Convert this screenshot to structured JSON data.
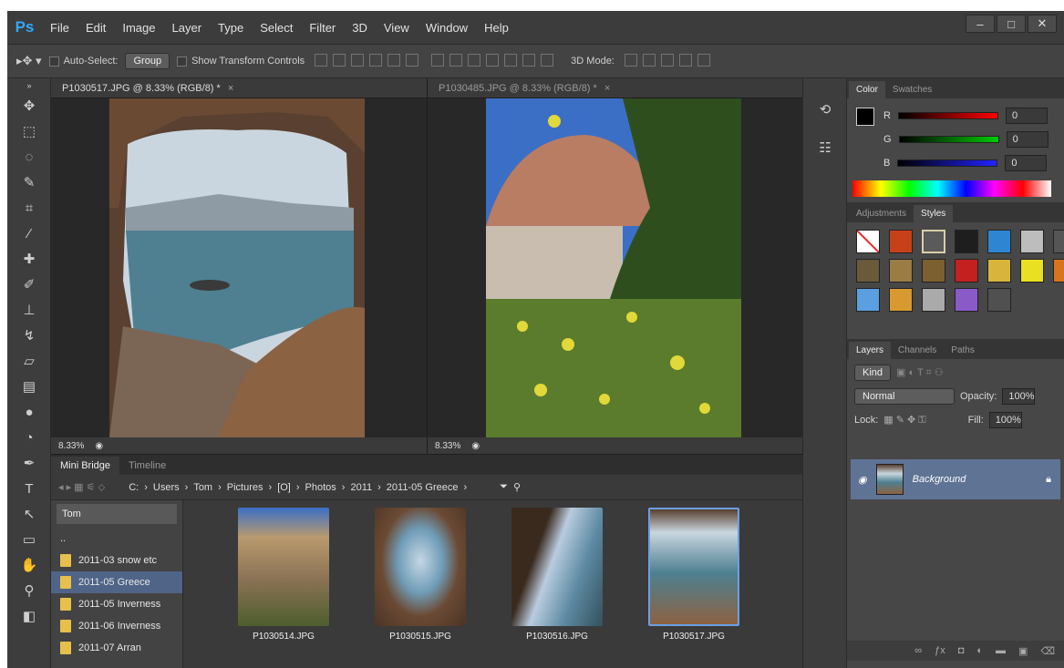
{
  "app": {
    "logo": "Ps"
  },
  "menu": [
    "File",
    "Edit",
    "Image",
    "Layer",
    "Type",
    "Select",
    "Filter",
    "3D",
    "View",
    "Window",
    "Help"
  ],
  "window_buttons": [
    "–",
    "□",
    "✕"
  ],
  "options": {
    "auto_select": "Auto-Select:",
    "group": "Group",
    "show_transform": "Show Transform Controls",
    "mode_3d": "3D Mode:"
  },
  "documents": [
    {
      "tab": "P1030517.JPG @ 8.33% (RGB/8) *",
      "zoom": "8.33%"
    },
    {
      "tab": "P1030485.JPG @ 8.33% (RGB/8) *",
      "zoom": "8.33%"
    }
  ],
  "bridge": {
    "tabs": [
      "Mini Bridge",
      "Timeline"
    ],
    "path": [
      "C:",
      "Users",
      "Tom",
      "Pictures",
      "[O]",
      "Photos",
      "2011",
      "2011-05 Greece"
    ],
    "folder_header": "Tom",
    "up": "..",
    "folders": [
      "2011-03 snow etc",
      "2011-05 Greece",
      "2011-05 Inverness",
      "2011-06 Inverness",
      "2011-07 Arran"
    ],
    "selected_folder": 1,
    "thumbs": [
      "P1030514.JPG",
      "P1030515.JPG",
      "P1030516.JPG",
      "P1030517.JPG"
    ]
  },
  "color_panel": {
    "tabs": [
      "Color",
      "Swatches"
    ],
    "r_label": "R",
    "g_label": "G",
    "b_label": "B",
    "r": "0",
    "g": "0",
    "b": "0"
  },
  "styles_panel": {
    "tabs": [
      "Adjustments",
      "Styles"
    ]
  },
  "layers_panel": {
    "tabs": [
      "Layers",
      "Channels",
      "Paths"
    ],
    "kind": "Kind",
    "mode": "Normal",
    "opacity_label": "Opacity:",
    "opacity": "100%",
    "lock_label": "Lock:",
    "fill_label": "Fill:",
    "fill": "100%",
    "layer_name": "Background"
  }
}
